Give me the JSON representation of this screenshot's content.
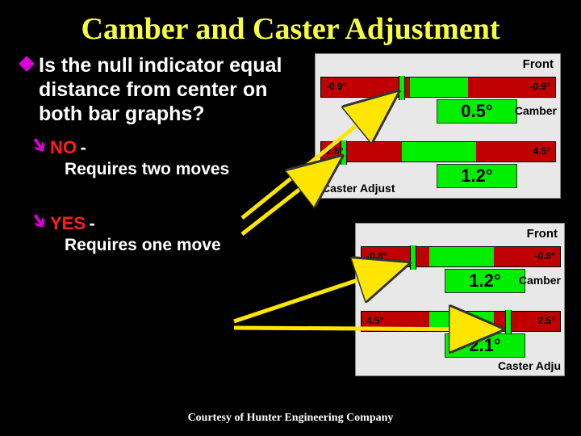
{
  "title": "Camber and Caster Adjustment",
  "question": "Is the null indicator equal distance from center on both bar graphs?",
  "answers": {
    "no": {
      "label": "NO",
      "suffix": "   -",
      "detail": "Requires two moves"
    },
    "yes": {
      "label": "YES",
      "suffix": " -",
      "detail": "Requires one move"
    }
  },
  "credit": "Courtesy of Hunter Engineering Company",
  "panel1": {
    "header": "Front",
    "camber": {
      "left": "-0.9°",
      "right": "-0.9°",
      "value": "0.5°",
      "label": "Camber"
    },
    "caster": {
      "left": "2.5°",
      "right": "4.5°",
      "value": "1.2°",
      "label": "Caster Adjust"
    }
  },
  "panel2": {
    "header": "Front",
    "camber": {
      "left": "-0.8°",
      "right": "-0.8°",
      "value": "1.2°",
      "label": "Camber"
    },
    "caster": {
      "left": "4.5°",
      "right": "2.5°",
      "value": "2.1°",
      "label": "Caster Adju"
    }
  }
}
